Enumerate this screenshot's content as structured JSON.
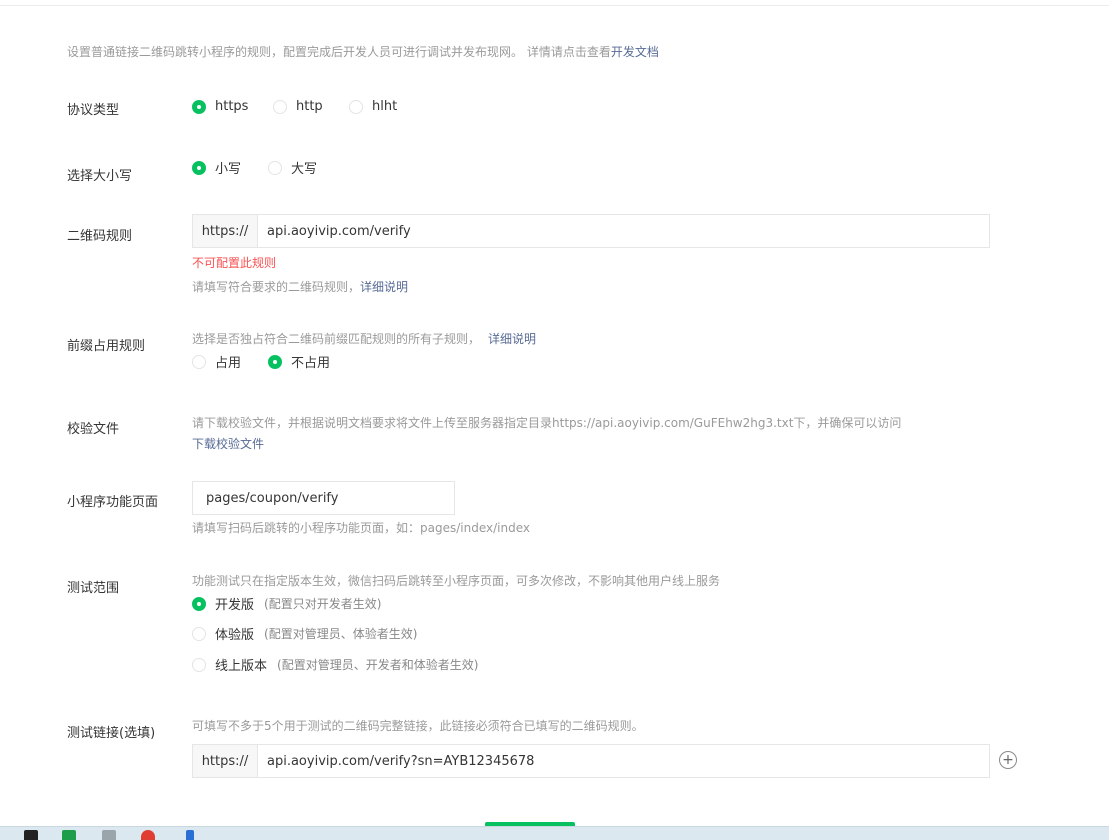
{
  "intro": {
    "text": "设置普通链接二维码跳转小程序的规则，配置完成后开发人员可进行调试并发布现网。 详情请点击查看",
    "link": "开发文档"
  },
  "protocol": {
    "label": "协议类型",
    "options": [
      "https",
      "http",
      "hlht"
    ],
    "selected": "https"
  },
  "case": {
    "label": "选择大小写",
    "options": [
      "小写",
      "大写"
    ],
    "selected": "小写"
  },
  "qr_rule": {
    "label": "二维码规则",
    "prefix": "https://",
    "value": "api.aoyivip.com/verify",
    "error": "不可配置此规则",
    "tip": "请填写符合要求的二维码规则，",
    "tip_link": "详细说明"
  },
  "prefix_rule": {
    "label": "前缀占用规则",
    "tip": "选择是否独占符合二维码前缀匹配规则的所有子规则，",
    "tip_link": "详细说明",
    "options": [
      "占用",
      "不占用"
    ],
    "selected": "不占用"
  },
  "verify_file": {
    "label": "校验文件",
    "tip": "请下载校验文件，并根据说明文档要求将文件上传至服务器指定目录https://api.aoyivip.com/GuFEhw2hg3.txt下，并确保可以访问",
    "download_link": "下载校验文件"
  },
  "page_path": {
    "label": "小程序功能页面",
    "value": "pages/coupon/verify",
    "tip": "请填写扫码后跳转的小程序功能页面，如：pages/index/index"
  },
  "test_scope": {
    "label": "测试范围",
    "tip": "功能测试只在指定版本生效，微信扫码后跳转至小程序页面，可多次修改，不影响其他用户线上服务",
    "options": [
      {
        "name": "开发版",
        "note": "(配置只对开发者生效)"
      },
      {
        "name": "体验版",
        "note": "(配置对管理员、体验者生效)"
      },
      {
        "name": "线上版本",
        "note": "(配置对管理员、开发者和体验者生效)"
      }
    ],
    "selected": "开发版"
  },
  "test_link": {
    "label": "测试链接(选填)",
    "tip": "可填写不多于5个用于测试的二维码完整链接，此链接必须符合已填写的二维码规则。",
    "prefix": "https://",
    "value": "api.aoyivip.com/verify?sn=AYB12345678",
    "add_icon": "plus-circle-icon"
  },
  "colors": {
    "accent": "#07c160",
    "link": "#576b95",
    "error": "#fa5151"
  }
}
